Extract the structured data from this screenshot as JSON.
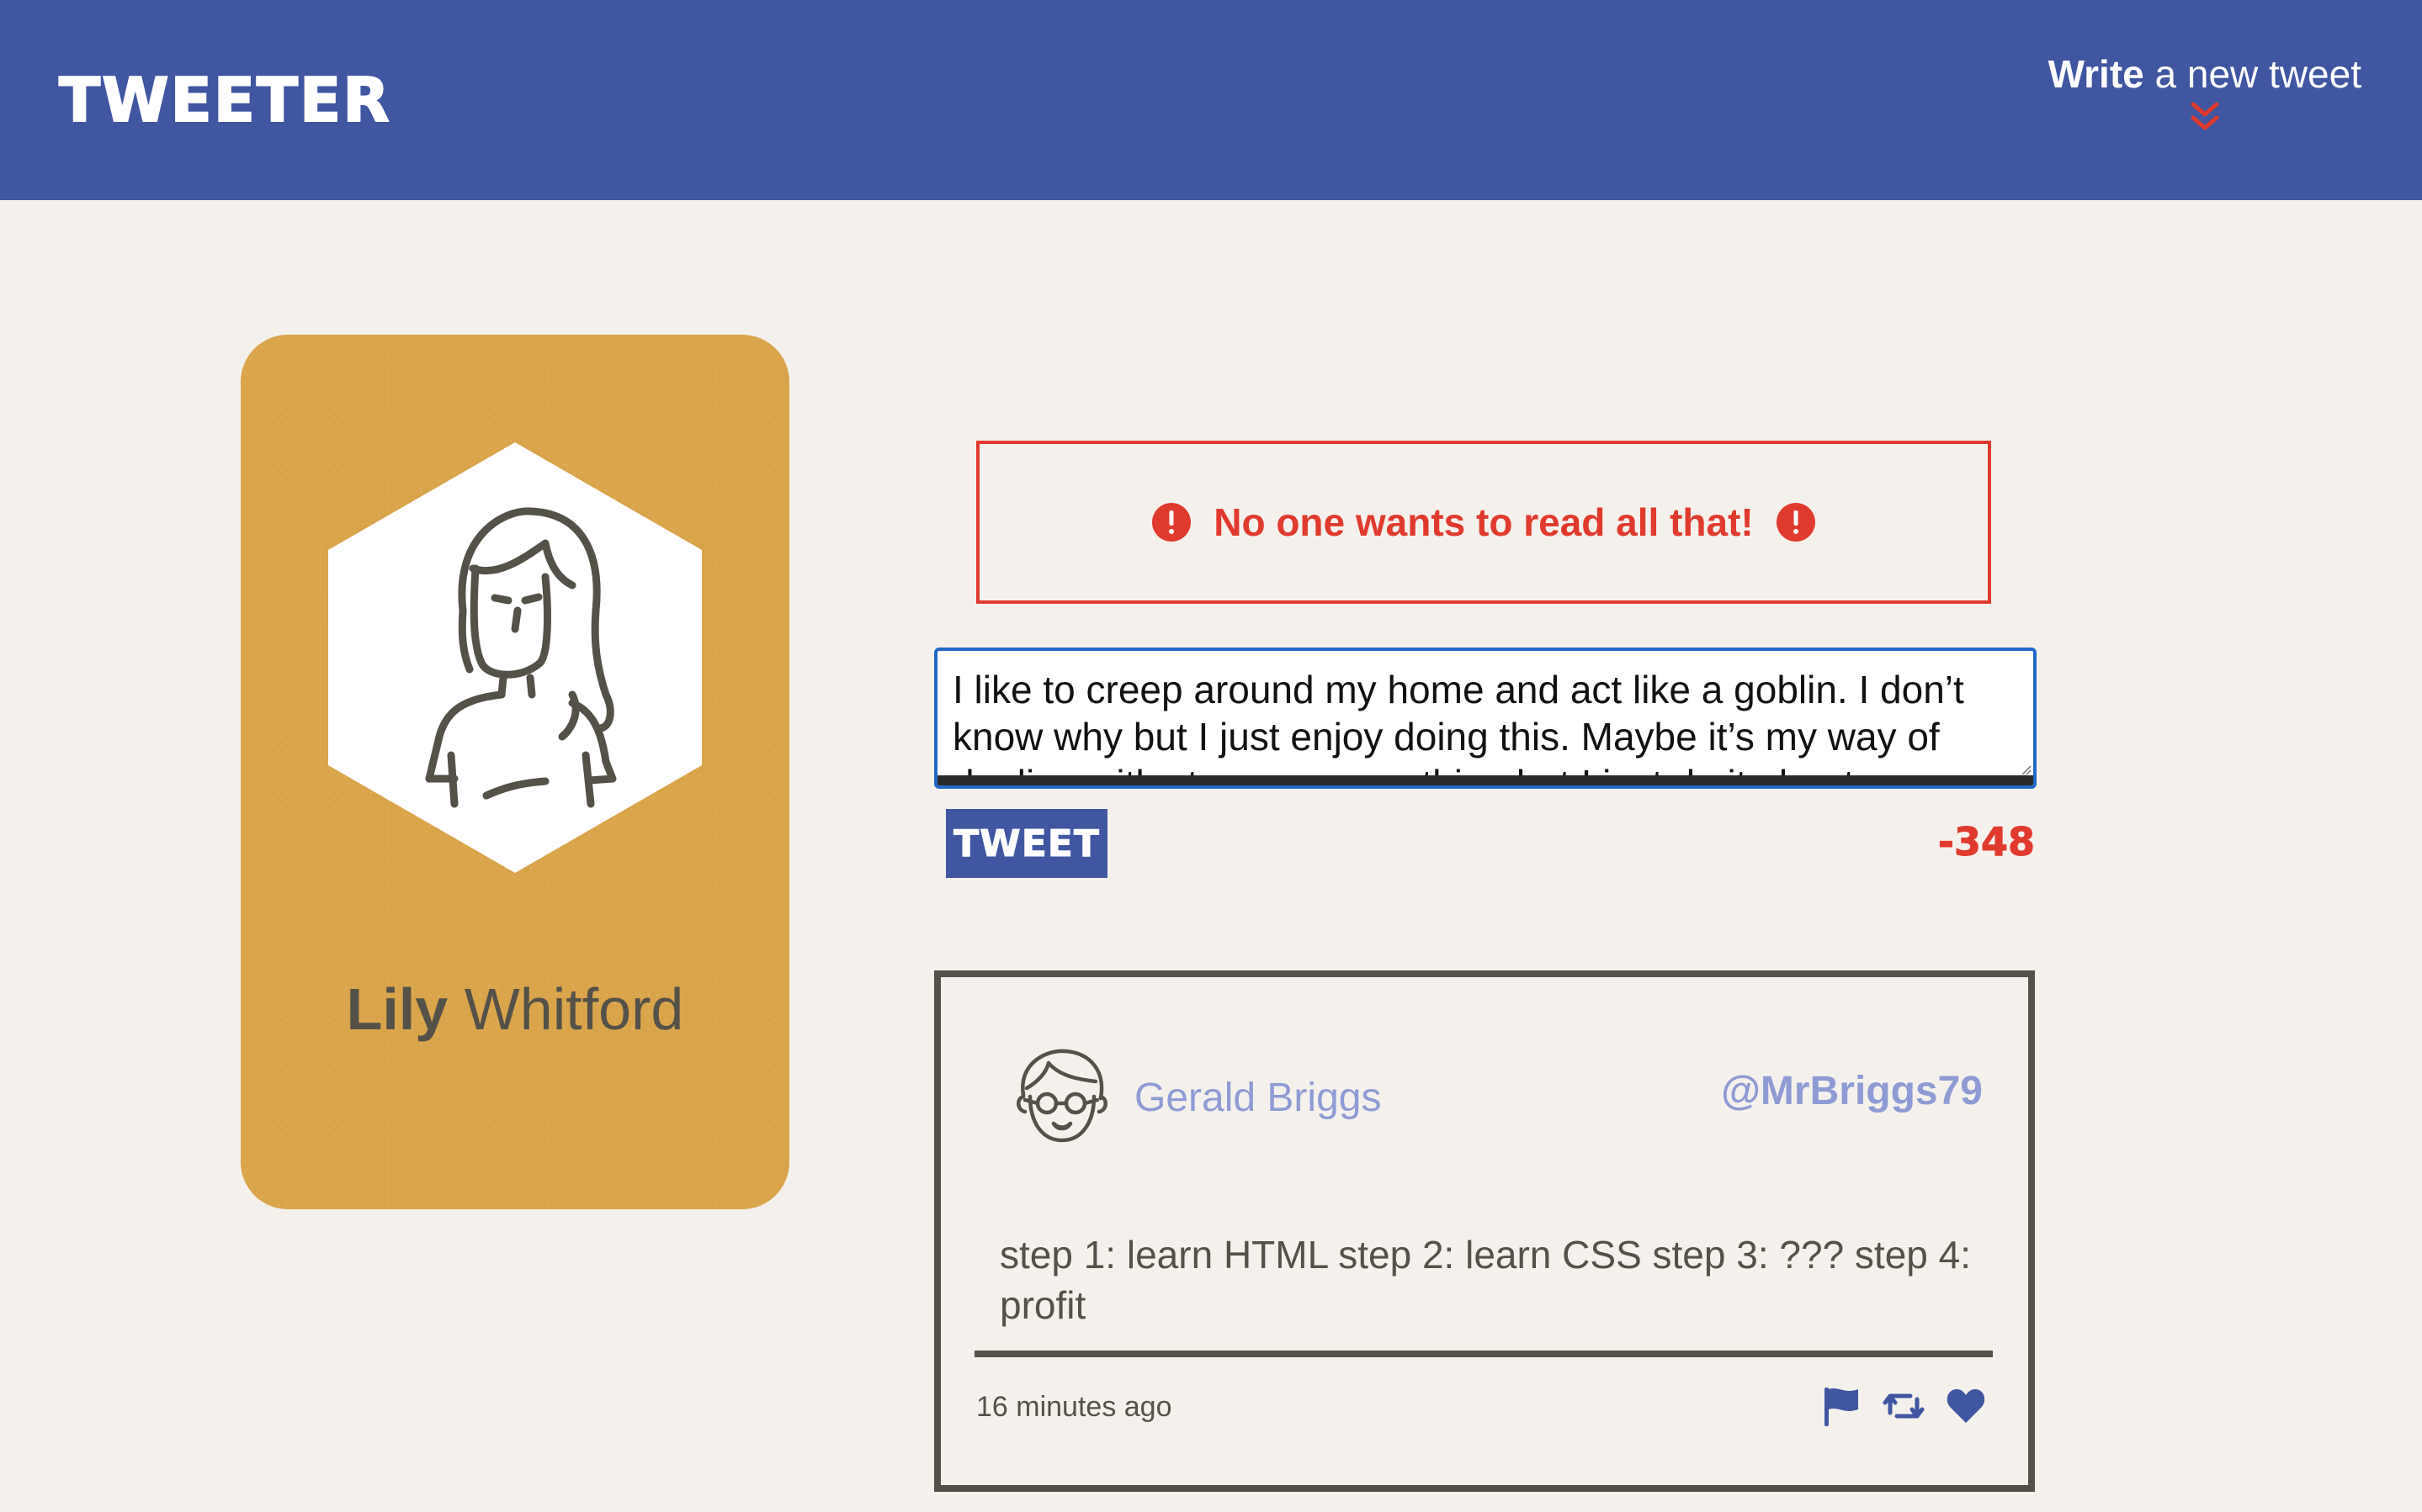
{
  "nav": {
    "brand": "TWEETER",
    "write_bold": "Write",
    "write_rest": "a new tweet",
    "chevron_icon": "double-chevron-down-icon",
    "bg_color": "#4056a1",
    "chevron_color": "#e03a2e"
  },
  "profile": {
    "first_name": "Lily",
    "last_name": "Whitford",
    "avatar_icon": "female-avatar-icon",
    "card_color": "#d9a44a"
  },
  "error": {
    "message": "No one wants to read all that!",
    "icon": "exclamation-circle-icon",
    "color": "#e03a2e"
  },
  "compose": {
    "text": "I like to creep around my home and act like a goblin. I don’t know why but I just enjoy doing this. Maybe it’s my way of dealing with stress or something but I just do it about once",
    "button_label": "TWEET",
    "counter": "-348"
  },
  "tweet": {
    "author": "Gerald Briggs",
    "handle": "@MrBriggs79",
    "content": "step 1: learn HTML step 2: learn CSS step 3: ??? step 4: profit",
    "time": "16 minutes ago",
    "avatar_icon": "male-glasses-avatar-icon",
    "actions": [
      "flag-icon",
      "retweet-icon",
      "heart-icon"
    ],
    "accent": "#8f9bd4"
  }
}
